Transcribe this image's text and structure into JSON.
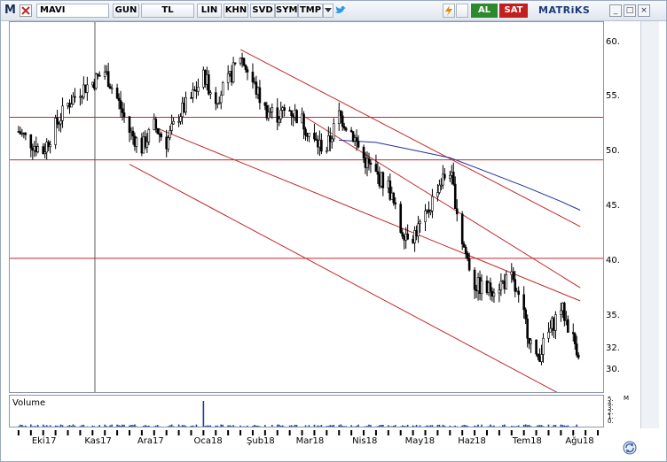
{
  "toolbar": {
    "symbol": "MAVI",
    "buttons": [
      "GUN",
      "TL",
      "LIN",
      "KHN",
      "SVD",
      "SYM",
      "TMP"
    ],
    "buy_label": "AL",
    "sell_label": "SAT",
    "brand": "MATRiKS"
  },
  "colors": {
    "channel_lines": "#c0292b",
    "horizontal_lines": "#c0292b",
    "moving_average": "#1f2fa0",
    "candles": "#000000",
    "volume_bars": "#1f3d8f",
    "buy": "#2c8a2c",
    "sell": "#c21f1f"
  },
  "price_axis": {
    "labels": [
      "60.",
      "55.",
      "50.",
      "45.",
      "40.",
      "35.",
      "32.",
      "30."
    ]
  },
  "volume_panel": {
    "title": "Volume",
    "axis_labels": [
      "M",
      "5.",
      "4.",
      "3.",
      "2.",
      "1.",
      "0."
    ]
  },
  "time_axis": {
    "labels": [
      "Eki17",
      "Kas17",
      "Ara17",
      "Oca18",
      "Şub18",
      "Mar18",
      "Nis18",
      "May18",
      "Haz18",
      "Tem18",
      "Ağu18"
    ]
  },
  "chart_data": {
    "type": "candlestick",
    "ylim": [
      28,
      62
    ],
    "horizontal_levels": [
      53.3,
      49.4,
      40.4
    ],
    "channel_lines": [
      {
        "from": [
          "2017-11-27",
          49.0
        ],
        "to": [
          "2018-08-10",
          27.0
        ]
      },
      {
        "from": [
          "2017-12-11",
          52.4
        ],
        "to": [
          "2018-08-10",
          36.5
        ]
      },
      {
        "from": [
          "2018-01-29",
          59.5
        ],
        "to": [
          "2018-08-10",
          43.3
        ]
      },
      {
        "from": [
          "2018-03-05",
          53.5
        ],
        "to": [
          "2018-08-10",
          37.7
        ]
      }
    ],
    "price_path": [
      [
        "2017-09-25",
        52.0
      ],
      [
        "2017-10-02",
        51.0
      ],
      [
        "2017-10-09",
        50.2
      ],
      [
        "2017-10-16",
        52.5
      ],
      [
        "2017-10-23",
        54.5
      ],
      [
        "2017-10-30",
        55.8
      ],
      [
        "2017-11-06",
        56.5
      ],
      [
        "2017-11-13",
        57.5
      ],
      [
        "2017-11-20",
        55.0
      ],
      [
        "2017-11-27",
        52.0
      ],
      [
        "2017-12-04",
        50.5
      ],
      [
        "2017-12-11",
        52.5
      ],
      [
        "2017-12-18",
        51.0
      ],
      [
        "2017-12-25",
        53.5
      ],
      [
        "2018-01-01",
        55.0
      ],
      [
        "2018-01-08",
        57.0
      ],
      [
        "2018-01-15",
        55.0
      ],
      [
        "2018-01-22",
        56.5
      ],
      [
        "2018-01-29",
        59.0
      ],
      [
        "2018-02-05",
        56.5
      ],
      [
        "2018-02-12",
        54.0
      ],
      [
        "2018-02-19",
        53.5
      ],
      [
        "2018-02-26",
        54.0
      ],
      [
        "2018-03-05",
        53.0
      ],
      [
        "2018-03-12",
        51.0
      ],
      [
        "2018-03-19",
        50.5
      ],
      [
        "2018-03-26",
        53.5
      ],
      [
        "2018-04-02",
        52.0
      ],
      [
        "2018-04-09",
        49.5
      ],
      [
        "2018-04-16",
        48.0
      ],
      [
        "2018-04-23",
        47.0
      ],
      [
        "2018-04-30",
        43.0
      ],
      [
        "2018-05-07",
        42.5
      ],
      [
        "2018-05-14",
        44.0
      ],
      [
        "2018-05-21",
        47.0
      ],
      [
        "2018-05-28",
        48.5
      ],
      [
        "2018-06-04",
        42.0
      ],
      [
        "2018-06-11",
        38.0
      ],
      [
        "2018-06-18",
        37.5
      ],
      [
        "2018-06-25",
        38.0
      ],
      [
        "2018-07-02",
        38.5
      ],
      [
        "2018-07-09",
        35.0
      ],
      [
        "2018-07-16",
        31.0
      ],
      [
        "2018-07-23",
        33.5
      ],
      [
        "2018-07-30",
        36.0
      ],
      [
        "2018-08-06",
        33.0
      ],
      [
        "2018-08-10",
        31.5
      ]
    ],
    "moving_average": [
      [
        "2018-03-26",
        51.2
      ],
      [
        "2018-04-16",
        51.0
      ],
      [
        "2018-05-07",
        50.3
      ],
      [
        "2018-05-28",
        49.6
      ],
      [
        "2018-06-18",
        48.3
      ],
      [
        "2018-07-09",
        47.0
      ],
      [
        "2018-07-30",
        45.6
      ],
      [
        "2018-08-10",
        44.8
      ]
    ]
  }
}
